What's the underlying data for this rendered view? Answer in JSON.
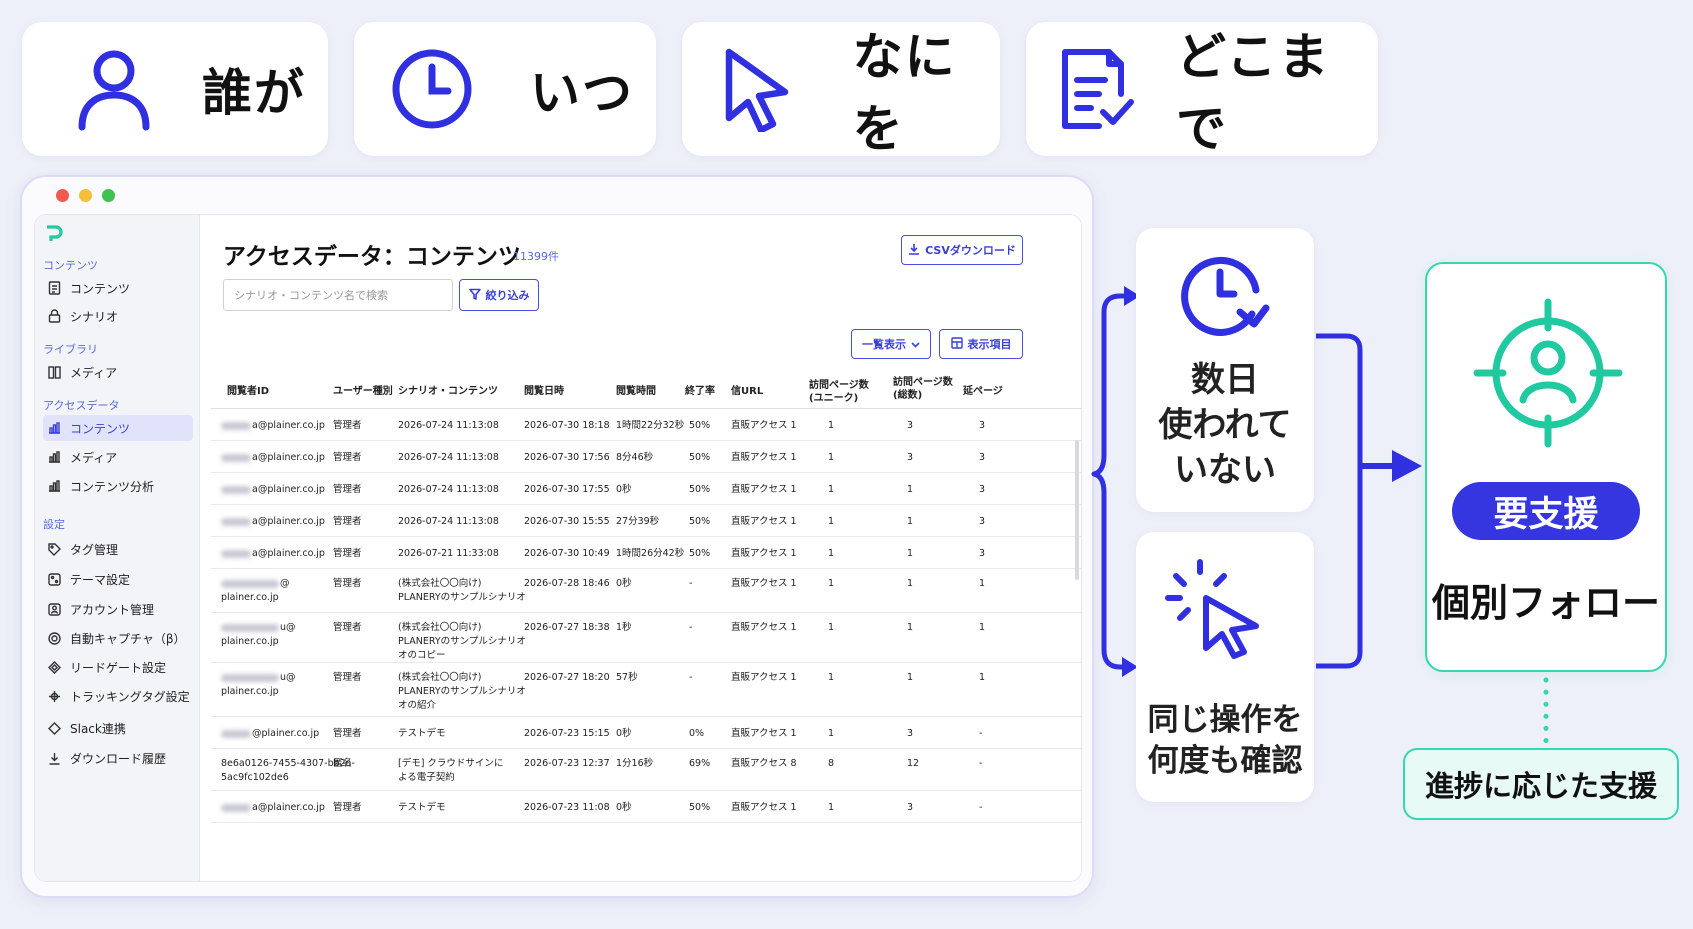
{
  "top_cards": [
    {
      "icon": "person-icon",
      "label": "誰が"
    },
    {
      "icon": "clock-icon",
      "label": "いつ"
    },
    {
      "icon": "cursor-icon",
      "label": "なにを"
    },
    {
      "icon": "document-check-icon",
      "label": "どこまで"
    }
  ],
  "sidebar": {
    "sections": [
      {
        "title": "コンテンツ",
        "items": [
          {
            "label": "コンテンツ",
            "icon": "document-icon"
          },
          {
            "label": "シナリオ",
            "icon": "lock-icon"
          }
        ]
      },
      {
        "title": "ライブラリ",
        "items": [
          {
            "label": "メディア",
            "icon": "media-icon"
          }
        ]
      },
      {
        "title": "アクセスデータ",
        "items": [
          {
            "label": "コンテンツ",
            "icon": "bar-chart-icon",
            "active": true
          },
          {
            "label": "メディア",
            "icon": "bar-chart-icon"
          },
          {
            "label": "コンテンツ分析",
            "icon": "bar-chart-icon"
          }
        ]
      },
      {
        "title": "設定",
        "items": [
          {
            "label": "タグ管理",
            "icon": "tag-icon"
          },
          {
            "label": "テーマ設定",
            "icon": "palette-icon"
          },
          {
            "label": "アカウント管理",
            "icon": "account-icon"
          },
          {
            "label": "自動キャプチャ（β）",
            "icon": "capture-icon"
          },
          {
            "label": "リードゲート設定",
            "icon": "gate-icon"
          },
          {
            "label": "トラッキングタグ設定",
            "icon": "tracking-icon"
          },
          {
            "label": "Slack連携",
            "icon": "slack-icon"
          },
          {
            "label": "ダウンロード履歴",
            "icon": "download-icon"
          }
        ]
      }
    ]
  },
  "main": {
    "title": "アクセスデータ：コンテンツ",
    "count": "11399件",
    "csv_button": "CSVダウンロード",
    "search_placeholder": "シナリオ・コンテンツ名で検索",
    "filter_button": "絞り込み",
    "list_view_button": "一覧表示",
    "columns_button": "表示項目"
  },
  "table": {
    "headers": [
      "閲覧者ID",
      "ユーザー種別",
      "シナリオ・コンテンツ",
      "閲覧日時",
      "閲覧時間",
      "終了率",
      "信URL",
      "訪問ページ数\n(ユニーク)",
      "訪問ページ数\n(総数)",
      "延ページ"
    ],
    "rows": [
      {
        "id_visible": "a@plainer.co.jp",
        "id_blur": true,
        "user_type": "管理者",
        "scenario": "2026-07-24 11:13:08",
        "datetime": "2026-07-30 18:18",
        "duration": "1時間22分32秒",
        "rate": "50%",
        "url": "直販アクセス 1",
        "unique": "1",
        "total": "3",
        "ext": "3"
      },
      {
        "id_visible": "a@plainer.co.jp",
        "id_blur": true,
        "user_type": "管理者",
        "scenario": "2026-07-24 11:13:08",
        "datetime": "2026-07-30 17:56",
        "duration": "8分46秒",
        "rate": "50%",
        "url": "直販アクセス 1",
        "unique": "1",
        "total": "3",
        "ext": "3"
      },
      {
        "id_visible": "a@plainer.co.jp",
        "id_blur": true,
        "user_type": "管理者",
        "scenario": "2026-07-24 11:13:08",
        "datetime": "2026-07-30 17:55",
        "duration": "0秒",
        "rate": "50%",
        "url": "直販アクセス 1",
        "unique": "1",
        "total": "1",
        "ext": "3"
      },
      {
        "id_visible": "a@plainer.co.jp",
        "id_blur": true,
        "user_type": "管理者",
        "scenario": "2026-07-24 11:13:08",
        "datetime": "2026-07-30 15:55",
        "duration": "27分39秒",
        "rate": "50%",
        "url": "直販アクセス 1",
        "unique": "1",
        "total": "1",
        "ext": "3"
      },
      {
        "id_visible": "a@plainer.co.jp",
        "id_blur": true,
        "user_type": "管理者",
        "scenario": "2026-07-21 11:33:08",
        "datetime": "2026-07-30 10:49",
        "duration": "1時間26分42秒",
        "rate": "50%",
        "url": "直販アクセス 1",
        "unique": "1",
        "total": "1",
        "ext": "3"
      },
      {
        "id_visible": "@\nplainer.co.jp",
        "id_blur": true,
        "user_type": "管理者",
        "scenario": "(株式会社〇〇向け)\nPLANERYのサンプルシナリオ",
        "datetime": "2026-07-28 18:46",
        "duration": "0秒",
        "rate": "-",
        "url": "直販アクセス 1",
        "unique": "1",
        "total": "1",
        "ext": "1"
      },
      {
        "id_visible": "u@\nplainer.co.jp",
        "id_blur": true,
        "user_type": "管理者",
        "scenario": "(株式会社〇〇向け)\nPLANERYのサンプルシナリオ\nオのコピー",
        "datetime": "2026-07-27 18:38",
        "duration": "1秒",
        "rate": "-",
        "url": "直販アクセス 1",
        "unique": "1",
        "total": "1",
        "ext": "1"
      },
      {
        "id_visible": "u@\nplainer.co.jp",
        "id_blur": true,
        "user_type": "管理者",
        "scenario": "(株式会社〇〇向け)\nPLANERYのサンプルシナリオ\nオの紹介",
        "datetime": "2026-07-27 18:20",
        "duration": "57秒",
        "rate": "-",
        "url": "直販アクセス 1",
        "unique": "1",
        "total": "1",
        "ext": "1"
      },
      {
        "id_visible": "@plainer.co.jp",
        "id_blur": true,
        "user_type": "管理者",
        "scenario": "テストデモ",
        "datetime": "2026-07-23 15:15",
        "duration": "0秒",
        "rate": "0%",
        "url": "直販アクセス 1",
        "unique": "1",
        "total": "3",
        "ext": "-"
      },
      {
        "id_visible": "8e6a0126-7455-4307-bb2a-\n5ac9fc102de6",
        "id_blur": false,
        "user_type": "匿名",
        "scenario": "[デモ] クラウドサインに\nよる電子契約",
        "datetime": "2026-07-23 12:37",
        "duration": "1分16秒",
        "rate": "69%",
        "url": "直販アクセス 8",
        "unique": "8",
        "total": "12",
        "ext": "-"
      },
      {
        "id_visible": "a@plainer.co.jp",
        "id_blur": true,
        "user_type": "管理者",
        "scenario": "テストデモ",
        "datetime": "2026-07-23 11:08",
        "duration": "0秒",
        "rate": "50%",
        "url": "直販アクセス 1",
        "unique": "1",
        "total": "3",
        "ext": "-"
      }
    ]
  },
  "insights": {
    "card1": "数日\n使われて\nいない",
    "card2": "同じ操作を\n何度も確認",
    "badge": "要支援",
    "result": "個別フォロー",
    "support": "進捗に応じた支援"
  },
  "colors": {
    "primary": "#3636e0",
    "teal": "#34d7b0",
    "dot_red": "#f05a4f",
    "dot_yellow": "#f4bf3a",
    "dot_green": "#3fc24f"
  }
}
